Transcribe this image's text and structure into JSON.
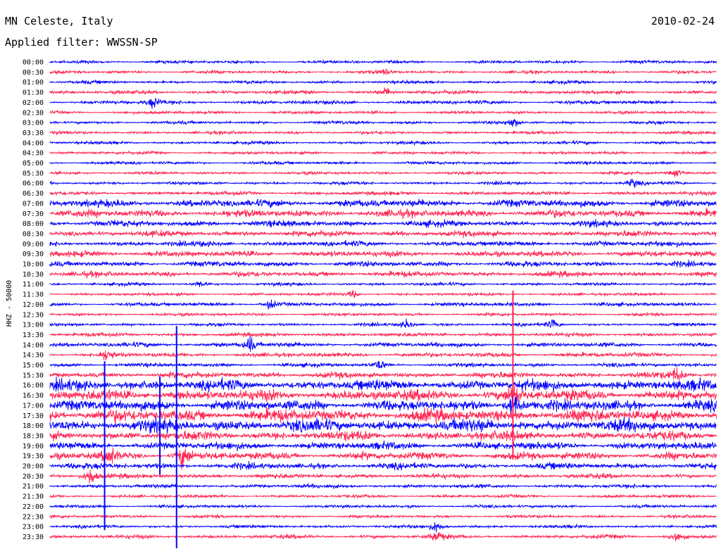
{
  "header": {
    "station": "MN Celeste, Italy",
    "date": "2010-02-24",
    "filter": "Applied filter: WWSSN-SP"
  },
  "chart_data": {
    "type": "line",
    "chart_kind": "helicorder",
    "ylabel": "HHZ - 50000",
    "row_labels": [
      "00:00",
      "00:30",
      "01:00",
      "01:30",
      "02:00",
      "02:30",
      "03:00",
      "03:30",
      "04:00",
      "04:30",
      "05:00",
      "05:30",
      "06:00",
      "06:30",
      "07:00",
      "07:30",
      "08:00",
      "08:30",
      "09:00",
      "09:30",
      "10:00",
      "10:30",
      "11:00",
      "11:30",
      "12:00",
      "12:30",
      "13:00",
      "13:30",
      "14:00",
      "14:30",
      "15:00",
      "15:30",
      "16:00",
      "16:30",
      "17:00",
      "17:30",
      "18:00",
      "18:30",
      "19:00",
      "19:30",
      "20:00",
      "20:30",
      "21:00",
      "21:30",
      "22:00",
      "22:30",
      "23:00",
      "23:30"
    ],
    "series_colors": [
      "#0000ff",
      "#ff2350"
    ],
    "noise_amplitude": [
      2,
      2,
      2,
      2.5,
      2.5,
      2,
      2,
      2,
      2,
      2,
      2,
      2,
      2,
      2.5,
      5,
      5,
      4,
      4,
      3.5,
      4,
      3.5,
      3.5,
      2,
      2,
      2.5,
      2,
      2,
      2.5,
      3,
      3,
      2.5,
      4,
      7,
      7,
      7,
      8,
      8,
      6,
      5,
      5,
      4,
      3,
      2.5,
      2,
      2,
      2,
      2,
      2.5
    ],
    "bursts": [
      {
        "row": 1,
        "t": 0.505,
        "amp": 4
      },
      {
        "row": 3,
        "t": 0.505,
        "amp": 6
      },
      {
        "row": 4,
        "t": 0.155,
        "amp": 8
      },
      {
        "row": 6,
        "t": 0.695,
        "amp": 7
      },
      {
        "row": 11,
        "t": 0.94,
        "amp": 6
      },
      {
        "row": 12,
        "t": 0.875,
        "amp": 7
      },
      {
        "row": 22,
        "t": 0.225,
        "amp": 5
      },
      {
        "row": 23,
        "t": 0.455,
        "amp": 6
      },
      {
        "row": 24,
        "t": 0.33,
        "amp": 8
      },
      {
        "row": 26,
        "t": 0.535,
        "amp": 7
      },
      {
        "row": 26,
        "t": 0.755,
        "amp": 7
      },
      {
        "row": 28,
        "t": 0.3,
        "amp": 12
      },
      {
        "row": 29,
        "t": 0.085,
        "amp": 9
      },
      {
        "row": 30,
        "t": 0.495,
        "amp": 7
      },
      {
        "row": 31,
        "t": 0.94,
        "amp": 9
      },
      {
        "row": 33,
        "t": 0.695,
        "amp": 14
      },
      {
        "row": 34,
        "t": 0.695,
        "amp": 22
      },
      {
        "row": 35,
        "t": 0.01,
        "amp": 6
      },
      {
        "row": 39,
        "t": 0.09,
        "amp": 12
      },
      {
        "row": 39,
        "t": 0.2,
        "amp": 18
      },
      {
        "row": 41,
        "t": 0.06,
        "amp": 14
      },
      {
        "row": 46,
        "t": 0.58,
        "amp": 9
      },
      {
        "row": 47,
        "t": 0.58,
        "amp": 8
      },
      {
        "row": 47,
        "t": 0.94,
        "amp": 10
      }
    ],
    "spikes": [
      {
        "row": 31,
        "t": 0.695,
        "len": 120
      },
      {
        "row": 38,
        "t": 0.19,
        "len": 170
      },
      {
        "row": 38,
        "t": 0.082,
        "len": 120
      },
      {
        "row": 36,
        "t": 0.165,
        "len": 70
      }
    ]
  }
}
